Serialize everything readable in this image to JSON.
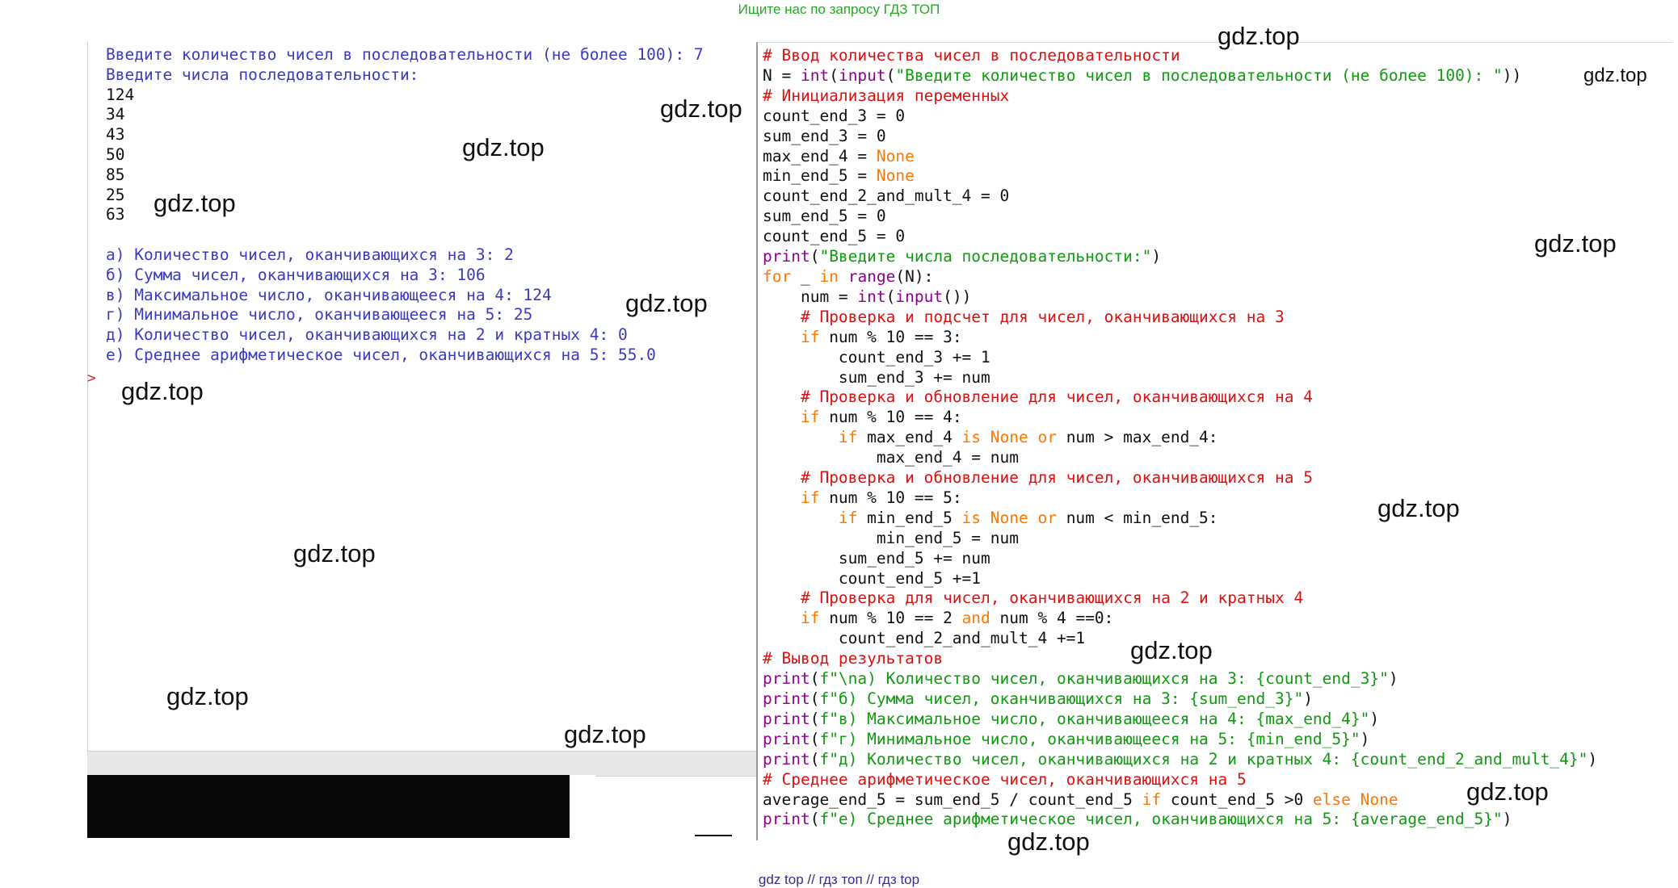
{
  "banner": "Ищите нас по запросу ГДЗ ТОП",
  "footer": "gdz top  //  гдз топ  //  гдз top",
  "shell": {
    "prompt_marker": ">",
    "lines": [
      {
        "text": "Введите количество чисел в последовательности (не более 100): 7",
        "color": "blue"
      },
      {
        "text": "Введите числа последовательности:",
        "color": "blue"
      },
      {
        "text": "124",
        "color": "black"
      },
      {
        "text": "34",
        "color": "black"
      },
      {
        "text": "43",
        "color": "black"
      },
      {
        "text": "50",
        "color": "black"
      },
      {
        "text": "85",
        "color": "black"
      },
      {
        "text": "25",
        "color": "black"
      },
      {
        "text": "63",
        "color": "black"
      },
      {
        "text": "",
        "color": "black"
      },
      {
        "text": "а) Количество чисел, оканчивающихся на 3: 2",
        "color": "blue"
      },
      {
        "text": "б) Сумма чисел, оканчивающихся на 3: 106",
        "color": "blue"
      },
      {
        "text": "в) Максимальное число, оканчивающееся на 4: 124",
        "color": "blue"
      },
      {
        "text": "г) Минимальное число, оканчивающееся на 5: 25",
        "color": "blue"
      },
      {
        "text": "д) Количество чисел, оканчивающихся на 2 и кратных 4: 0",
        "color": "blue"
      },
      {
        "text": "е) Среднее арифметическое чисел, оканчивающихся на 5: 55.0",
        "color": "blue"
      }
    ]
  },
  "code": {
    "lines": [
      [
        [
          "com",
          "# Ввод количества чисел в последовательности"
        ]
      ],
      [
        [
          "plain",
          "N = "
        ],
        [
          "bi",
          "int"
        ],
        [
          "plain",
          "("
        ],
        [
          "bi",
          "input"
        ],
        [
          "plain",
          "("
        ],
        [
          "str",
          "\"Введите количество чисел в последовательности (не более 100): \""
        ],
        [
          "plain",
          "))"
        ]
      ],
      [
        [
          "com",
          "# Инициализация переменных"
        ]
      ],
      [
        [
          "plain",
          "count_end_3 = 0"
        ]
      ],
      [
        [
          "plain",
          "sum_end_3 = 0"
        ]
      ],
      [
        [
          "plain",
          "max_end_4 = "
        ],
        [
          "kw",
          "None"
        ]
      ],
      [
        [
          "plain",
          "min_end_5 = "
        ],
        [
          "kw",
          "None"
        ]
      ],
      [
        [
          "plain",
          "count_end_2_and_mult_4 = 0"
        ]
      ],
      [
        [
          "plain",
          "sum_end_5 = 0"
        ]
      ],
      [
        [
          "plain",
          "count_end_5 = 0"
        ]
      ],
      [
        [
          "bi",
          "print"
        ],
        [
          "plain",
          "("
        ],
        [
          "str",
          "\"Введите числа последовательности:\""
        ],
        [
          "plain",
          ")"
        ]
      ],
      [
        [
          "kw",
          "for"
        ],
        [
          "plain",
          " _ "
        ],
        [
          "kw",
          "in"
        ],
        [
          "plain",
          " "
        ],
        [
          "bi",
          "range"
        ],
        [
          "plain",
          "(N):"
        ]
      ],
      [
        [
          "plain",
          "    num = "
        ],
        [
          "bi",
          "int"
        ],
        [
          "plain",
          "("
        ],
        [
          "bi",
          "input"
        ],
        [
          "plain",
          "())"
        ]
      ],
      [
        [
          "plain",
          "    "
        ],
        [
          "com",
          "# Проверка и подсчет для чисел, оканчивающихся на 3"
        ]
      ],
      [
        [
          "plain",
          "    "
        ],
        [
          "kw",
          "if"
        ],
        [
          "plain",
          " num % 10 == 3:"
        ]
      ],
      [
        [
          "plain",
          "        count_end_3 += 1"
        ]
      ],
      [
        [
          "plain",
          "        sum_end_3 += num"
        ]
      ],
      [
        [
          "plain",
          "    "
        ],
        [
          "com",
          "# Проверка и обновление для чисел, оканчивающихся на 4"
        ]
      ],
      [
        [
          "plain",
          "    "
        ],
        [
          "kw",
          "if"
        ],
        [
          "plain",
          " num % 10 == 4:"
        ]
      ],
      [
        [
          "plain",
          "        "
        ],
        [
          "kw",
          "if"
        ],
        [
          "plain",
          " max_end_4 "
        ],
        [
          "kw",
          "is None or"
        ],
        [
          "plain",
          " num > max_end_4:"
        ]
      ],
      [
        [
          "plain",
          "            max_end_4 = num"
        ]
      ],
      [
        [
          "plain",
          "    "
        ],
        [
          "com",
          "# Проверка и обновление для чисел, оканчивающихся на 5"
        ]
      ],
      [
        [
          "plain",
          "    "
        ],
        [
          "kw",
          "if"
        ],
        [
          "plain",
          " num % 10 == 5:"
        ]
      ],
      [
        [
          "plain",
          "        "
        ],
        [
          "kw",
          "if"
        ],
        [
          "plain",
          " min_end_5 "
        ],
        [
          "kw",
          "is None or"
        ],
        [
          "plain",
          " num < min_end_5:"
        ]
      ],
      [
        [
          "plain",
          "            min_end_5 = num"
        ]
      ],
      [
        [
          "plain",
          "        sum_end_5 += num"
        ]
      ],
      [
        [
          "plain",
          "        count_end_5 +=1"
        ]
      ],
      [
        [
          "plain",
          "    "
        ],
        [
          "com",
          "# Проверка для чисел, оканчивающихся на 2 и кратных 4"
        ]
      ],
      [
        [
          "plain",
          "    "
        ],
        [
          "kw",
          "if"
        ],
        [
          "plain",
          " num % 10 == 2 "
        ],
        [
          "kw",
          "and"
        ],
        [
          "plain",
          " num % 4 ==0:"
        ]
      ],
      [
        [
          "plain",
          "        count_end_2_and_mult_4 +=1"
        ]
      ],
      [
        [
          "com",
          "# Вывод результатов"
        ]
      ],
      [
        [
          "bi",
          "print"
        ],
        [
          "plain",
          "("
        ],
        [
          "str",
          "f\"\\nа) Количество чисел, оканчивающихся на 3: {count_end_3}\""
        ],
        [
          "plain",
          ")"
        ]
      ],
      [
        [
          "bi",
          "print"
        ],
        [
          "plain",
          "("
        ],
        [
          "str",
          "f\"б) Сумма чисел, оканчивающихся на 3: {sum_end_3}\""
        ],
        [
          "plain",
          ")"
        ]
      ],
      [
        [
          "bi",
          "print"
        ],
        [
          "plain",
          "("
        ],
        [
          "str",
          "f\"в) Максимальное число, оканчивающееся на 4: {max_end_4}\""
        ],
        [
          "plain",
          ")"
        ]
      ],
      [
        [
          "bi",
          "print"
        ],
        [
          "plain",
          "("
        ],
        [
          "str",
          "f\"г) Минимальное число, оканчивающееся на 5: {min_end_5}\""
        ],
        [
          "plain",
          ")"
        ]
      ],
      [
        [
          "bi",
          "print"
        ],
        [
          "plain",
          "("
        ],
        [
          "str",
          "f\"д) Количество чисел, оканчивающихся на 2 и кратных 4: {count_end_2_and_mult_4}\""
        ],
        [
          "plain",
          ")"
        ]
      ],
      [
        [
          "com",
          "# Среднее арифметическое чисел, оканчивающихся на 5"
        ]
      ],
      [
        [
          "plain",
          "average_end_5 = sum_end_5 / count_end_5 "
        ],
        [
          "kw",
          "if"
        ],
        [
          "plain",
          " count_end_5 >0 "
        ],
        [
          "kw",
          "else None"
        ]
      ],
      [
        [
          "bi",
          "print"
        ],
        [
          "plain",
          "("
        ],
        [
          "str",
          "f\"е) Среднее арифметическое чисел, оканчивающихся на 5: {average_end_5}\""
        ],
        [
          "plain",
          ")"
        ]
      ]
    ]
  },
  "watermarks": [
    "gdz.top",
    "gdz.top",
    "gdz.top",
    "gdz.top",
    "gdz.top",
    "gdz.top",
    "gdz.top",
    "gdz.top",
    "gdz.top",
    "gdz.top",
    "gdz.top",
    "gdz.top",
    "gdz.top",
    "gdz.top",
    "gdz.top"
  ]
}
